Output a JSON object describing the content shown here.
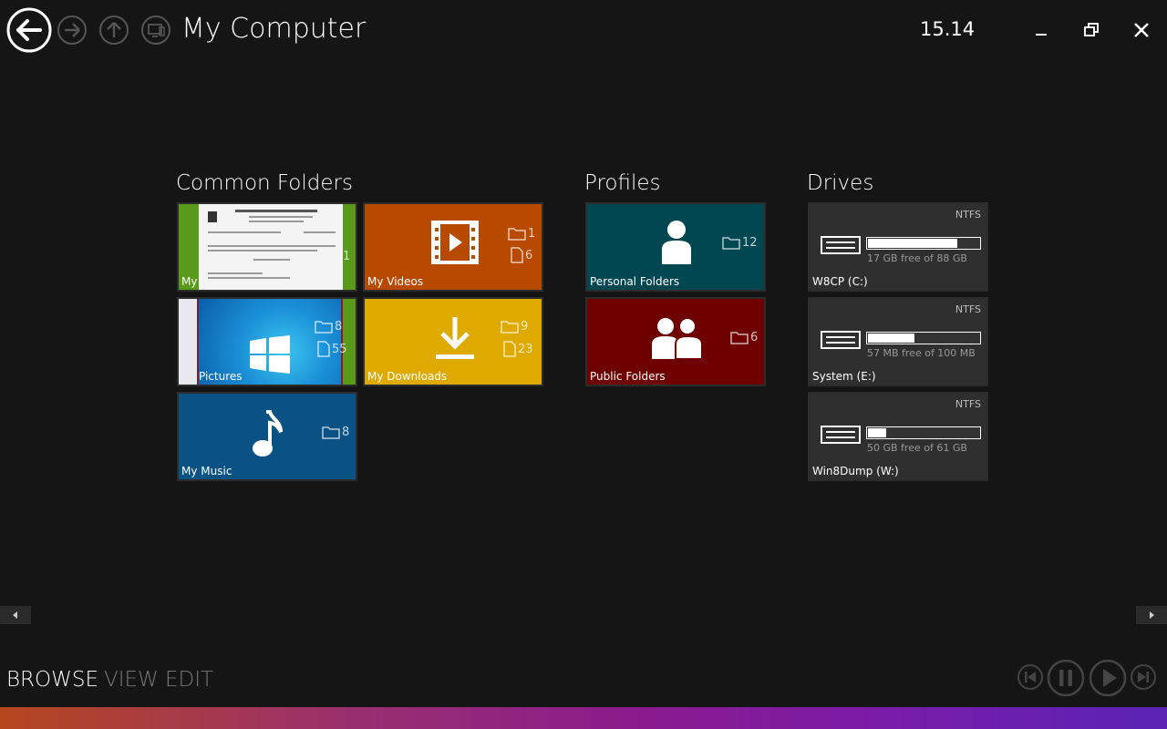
{
  "header": {
    "title": "My Computer",
    "clock": "15.14"
  },
  "sections": {
    "common": "Common Folders",
    "profiles": "Profiles",
    "drives": "Drives"
  },
  "common_folders": [
    {
      "label": "My",
      "folders": null,
      "files": "1",
      "color": "#5a9a1a"
    },
    {
      "label": "My Videos",
      "folders": "1",
      "files": "6",
      "color": "#b84a00"
    },
    {
      "label": "Pictures",
      "folders": "8",
      "files": "55",
      "color": "#1273b5"
    },
    {
      "label": "My Downloads",
      "folders": "9",
      "files": "23",
      "color": "#deaa00"
    },
    {
      "label": "My Music",
      "folders": "8",
      "files": null,
      "color": "#0a5283"
    }
  ],
  "profiles": [
    {
      "label": "Personal Folders",
      "folders": "12",
      "color": "#004751"
    },
    {
      "label": "Public Folders",
      "folders": "6",
      "color": "#6e0000"
    }
  ],
  "drives": [
    {
      "label": "W8CP (C:)",
      "fs": "NTFS",
      "free": "17 GB free of 88 GB",
      "used_fraction": 0.81
    },
    {
      "label": "System (E:)",
      "fs": "NTFS",
      "free": "57 MB free of 100 MB",
      "used_fraction": 0.43
    },
    {
      "label": "Win8Dump (W:)",
      "fs": "NTFS",
      "free": "50 GB free of 61 GB",
      "used_fraction": 0.18
    }
  ],
  "modes": {
    "browse": "BROWSE",
    "view": "VIEW",
    "edit": "EDIT"
  },
  "colors": {
    "drive_tile": "#2f2f2f"
  }
}
